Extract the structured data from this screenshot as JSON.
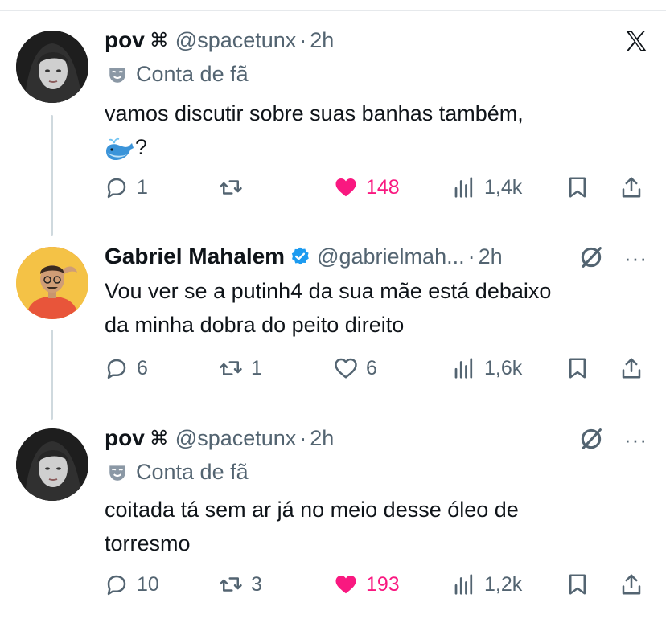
{
  "tweets": [
    {
      "name": "pov",
      "name_glyph": "⌘",
      "handle": "@spacetunx",
      "sep": "·",
      "time": "2h",
      "subline": "Conta de fã",
      "text_line1": "vamos discutir sobre suas banhas também,",
      "text_line2": "?",
      "actions": {
        "replies": "1",
        "retweets": "",
        "likes": "148",
        "views": "1,4k"
      },
      "liked": true
    },
    {
      "name": "Gabriel Mahalem",
      "handle": "@gabrielmah...",
      "sep": "·",
      "time": "2h",
      "text_line1": "Vou ver se a putinh4 da sua mãe está debaixo",
      "text_line2": "da minha dobra do peito direito",
      "actions": {
        "replies": "6",
        "retweets": "1",
        "likes": "6",
        "views": "1,6k"
      },
      "liked": false
    },
    {
      "name": "pov",
      "name_glyph": "⌘",
      "handle": "@spacetunx",
      "sep": "·",
      "time": "2h",
      "subline": "Conta de fã",
      "text_line1": "coitada tá sem ar já no meio desse óleo de",
      "text_line2": "torresmo",
      "actions": {
        "replies": "10",
        "retweets": "3",
        "likes": "193",
        "views": "1,2k"
      },
      "liked": true
    }
  ],
  "more_label": "···",
  "colors": {
    "like": "#f91880",
    "muted": "#536471",
    "verified": "#1d9bf0",
    "text": "#0f1419"
  },
  "icons": [
    "x-logo-icon",
    "reply-icon",
    "retweet-icon",
    "heart-icon",
    "views-icon",
    "bookmark-icon",
    "share-icon",
    "grok-icon",
    "more-icon",
    "verified-badge-icon",
    "fan-account-icon",
    "whale-emoji-icon"
  ]
}
